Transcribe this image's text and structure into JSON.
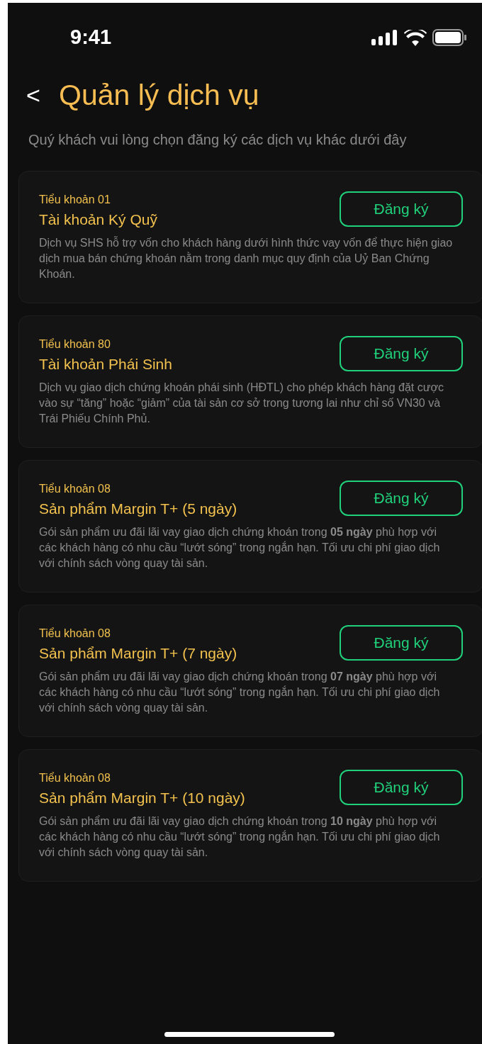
{
  "status_bar": {
    "time": "9:41"
  },
  "header": {
    "back": "<",
    "title": "Quản lý dịch vụ",
    "subtitle": "Quý khách vui lòng chọn đăng ký các dịch vụ khác dưới đây"
  },
  "services": [
    {
      "account": "Tiểu khoản 01",
      "name": "Tài khoản Ký Quỹ",
      "description": "Dịch vụ SHS hỗ trợ vốn cho khách hàng dưới hình thức vay vốn để thực hiện giao dịch mua bán chứng khoán nằm trong danh mục quy định của Uỷ Ban Chứng Khoán.",
      "button": "Đăng ký"
    },
    {
      "account": "Tiểu khoản 80",
      "name": "Tài khoản Phái Sinh",
      "description": "Dịch vụ giao dịch chứng khoán phái sinh (HĐTL) cho phép khách hàng đặt cược vào sự “tăng” hoặc “giảm” của tài sản cơ sở trong tương lai như chỉ số VN30 và Trái Phiếu Chính Phủ.",
      "button": "Đăng ký"
    },
    {
      "account": "Tiểu khoản 08",
      "name": "Sản phẩm Margin T+ (5 ngày)",
      "description": "Gói sản phẩm ưu đãi lãi vay giao dịch chứng khoán trong **05 ngày** phù hợp với các khách hàng có nhu cầu “lướt sóng” trong ngắn hạn. Tối ưu chi phí giao dịch với chính sách vòng quay tài sản.",
      "button": "Đăng ký"
    },
    {
      "account": "Tiểu khoản 08",
      "name": "Sản phẩm Margin T+ (7 ngày)",
      "description": "Gói sản phẩm ưu đãi lãi vay giao dịch chứng khoán trong **07 ngày** phù hợp với các khách hàng có nhu cầu “lướt sóng” trong ngắn hạn. Tối ưu chi phí giao dịch với chính sách vòng quay tài sản.",
      "button": "Đăng ký"
    },
    {
      "account": "Tiểu khoản 08",
      "name": "Sản phẩm Margin T+ (10 ngày)",
      "description": "Gói sản phẩm ưu đãi lãi vay giao dịch chứng khoán trong **10 ngày** phù hợp với các khách hàng có nhu cầu “lướt sóng” trong ngắn hạn. Tối ưu chi phí giao dịch với chính sách vòng quay tài sản.",
      "button": "Đăng ký"
    }
  ]
}
